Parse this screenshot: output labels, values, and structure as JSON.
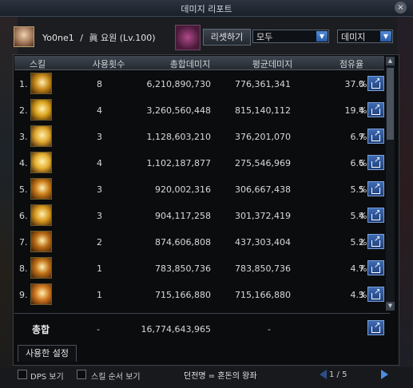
{
  "window": {
    "title": "데미지 리포트",
    "close_label": "×"
  },
  "character": {
    "name": "Yo0ne1",
    "separator": "/",
    "class": "眞 요원",
    "level": "(Lv.100)"
  },
  "toolbar": {
    "reset_label": "리셋하기",
    "filter_value": "모두",
    "sort_value": "데미지"
  },
  "table": {
    "headers": {
      "skill": "스킬",
      "uses": "사용횟수",
      "total": "총합데미지",
      "avg": "평균데미지",
      "share": "점유율"
    },
    "rows": [
      {
        "rank": "1.",
        "uses": "8",
        "total": "6,210,890,730",
        "avg": "776,361,341",
        "share": "37.0",
        "pct": "%",
        "icon_color": "#c78a1a",
        "icon": "rising-blades-skill-icon"
      },
      {
        "rank": "2.",
        "uses": "4",
        "total": "3,260,560,448",
        "avg": "815,140,112",
        "share": "19.4",
        "pct": "%",
        "icon_color": "#d8a21c",
        "icon": "burst-skill-icon"
      },
      {
        "rank": "3.",
        "uses": "3",
        "total": "1,128,603,210",
        "avg": "376,201,070",
        "share": "6.7",
        "pct": "%",
        "icon_color": "#e0a830",
        "icon": "starburst-skill-icon"
      },
      {
        "rank": "4.",
        "uses": "4",
        "total": "1,102,187,877",
        "avg": "275,546,969",
        "share": "6.6",
        "pct": "%",
        "icon_color": "#e6b030",
        "icon": "ring-skill-icon"
      },
      {
        "rank": "5.",
        "uses": "3",
        "total": "920,002,316",
        "avg": "306,667,438",
        "share": "5.5",
        "pct": "%",
        "icon_color": "#c87a18",
        "icon": "swirl-skill-icon"
      },
      {
        "rank": "6.",
        "uses": "3",
        "total": "904,117,258",
        "avg": "301,372,419",
        "share": "5.4",
        "pct": "%",
        "icon_color": "#d89a20",
        "icon": "dash-skill-icon"
      },
      {
        "rank": "7.",
        "uses": "2",
        "total": "874,606,808",
        "avg": "437,303,404",
        "share": "5.2",
        "pct": "%",
        "icon_color": "#b86a14",
        "icon": "strike-skill-icon"
      },
      {
        "rank": "8.",
        "uses": "1",
        "total": "783,850,736",
        "avg": "783,850,736",
        "share": "4.7",
        "pct": "%",
        "icon_color": "#c07018",
        "icon": "flame-orb-skill-icon"
      },
      {
        "rank": "9.",
        "uses": "1",
        "total": "715,166,880",
        "avg": "715,166,880",
        "share": "4.3",
        "pct": "%",
        "icon_color": "#d07820",
        "icon": "lightning-skill-icon"
      }
    ],
    "total_row": {
      "label": "총합",
      "uses": "-",
      "total": "16,774,643,965",
      "avg": "-"
    }
  },
  "tabs": {
    "used_settings": "사용한 설정"
  },
  "footer": {
    "dps_label": "DPS 보기",
    "skill_order_label": "스킬 순서 보기",
    "dungeon_label": "던전명 = 혼돈의 왕좌",
    "page": "1 / 5"
  }
}
